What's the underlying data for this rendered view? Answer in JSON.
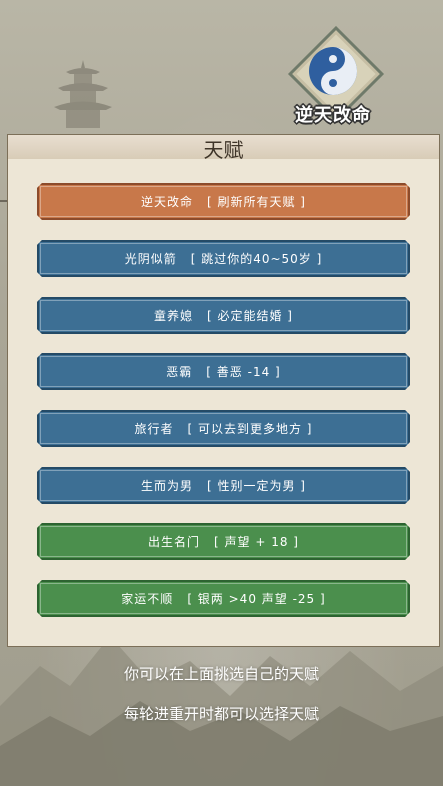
{
  "brand": {
    "title": "逆天改命",
    "icon": "yin-yang-icon"
  },
  "panel": {
    "title": "天赋"
  },
  "talents": [
    {
      "name": "逆天改命",
      "effect": "[ 刷新所有天赋 ]",
      "tier": "orange"
    },
    {
      "name": "光阴似箭",
      "effect": "[ 跳过你的40~50岁 ]",
      "tier": "blue"
    },
    {
      "name": "童养媳",
      "effect": "[ 必定能结婚 ]",
      "tier": "blue"
    },
    {
      "name": "恶霸",
      "effect": "[ 善恶 -14 ]",
      "tier": "blue"
    },
    {
      "name": "旅行者",
      "effect": "[ 可以去到更多地方 ]",
      "tier": "blue"
    },
    {
      "name": "生而为男",
      "effect": "[ 性别一定为男 ]",
      "tier": "blue"
    },
    {
      "name": "出生名门",
      "effect": "[ 声望 + 18 ]",
      "tier": "green"
    },
    {
      "name": "家运不顺",
      "effect": "[ 银两 >40 声望 -25 ]",
      "tier": "green"
    }
  ],
  "hints": {
    "line1": "你可以在上面挑选自己的天赋",
    "line2": "每轮进重开时都可以选择天赋"
  },
  "colors": {
    "orange": "#c8784a",
    "blue": "#3d6f94",
    "green": "#4b8f4d",
    "panel": "#ece4d1"
  }
}
